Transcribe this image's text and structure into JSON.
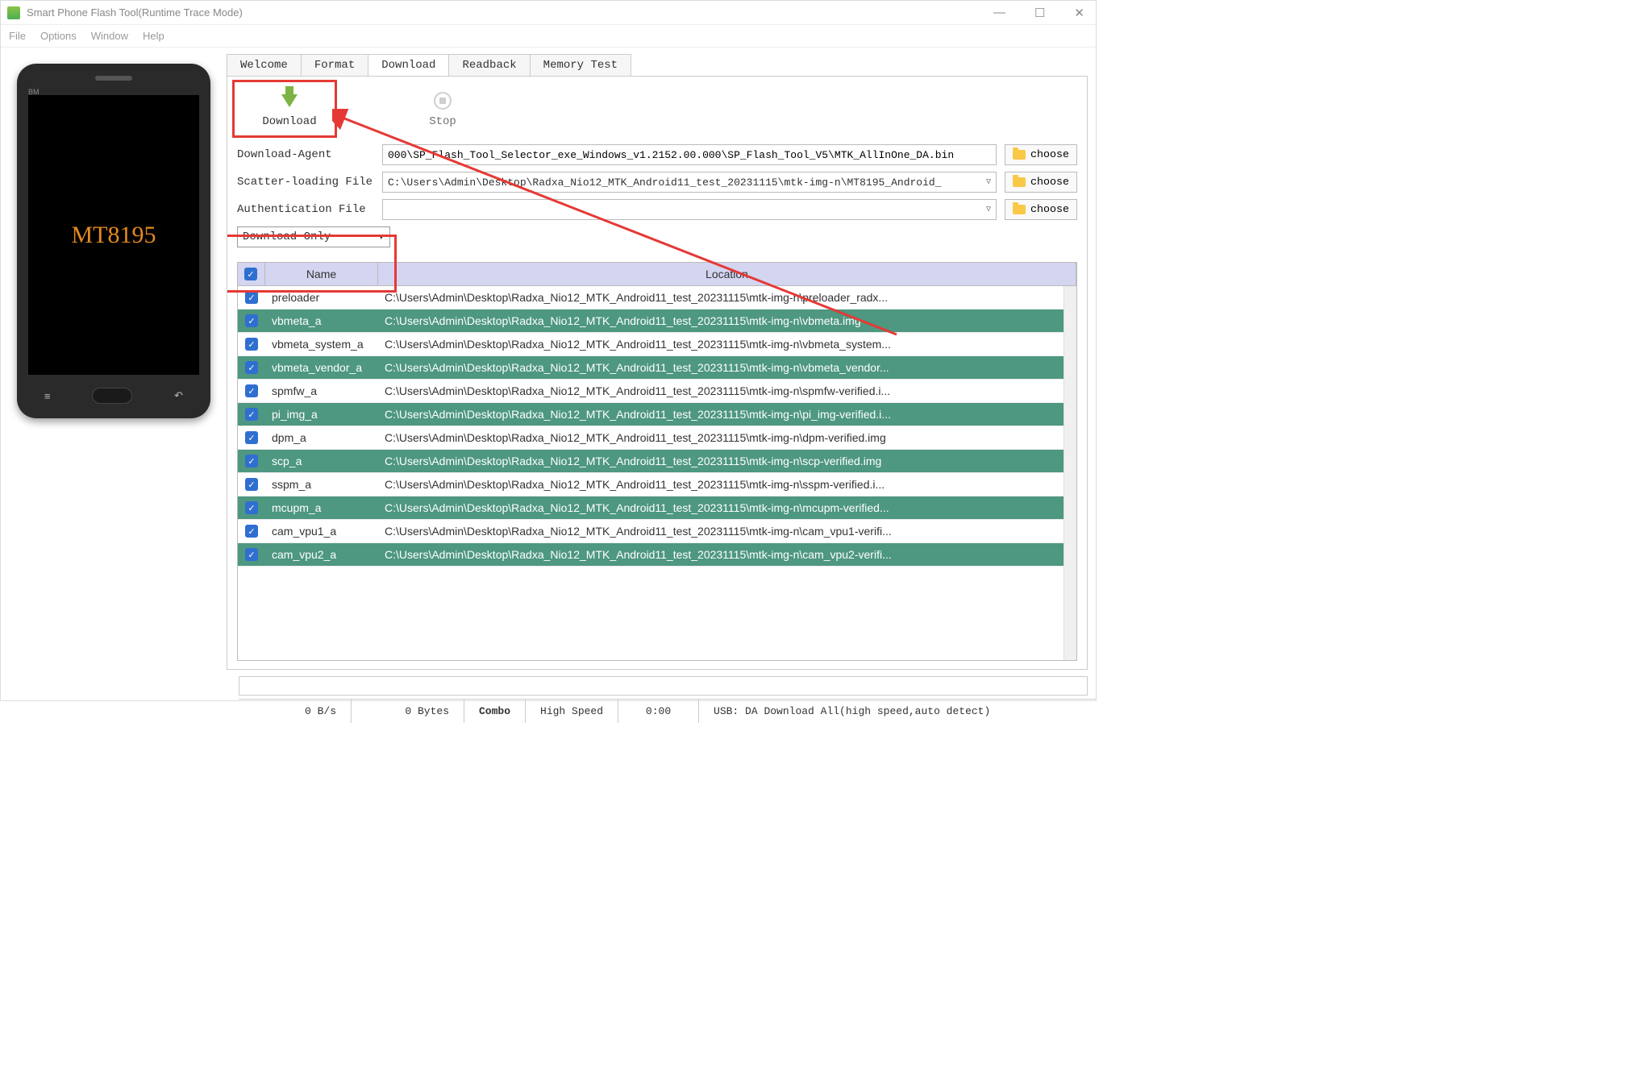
{
  "window": {
    "title": "Smart Phone Flash Tool(Runtime Trace Mode)"
  },
  "menu": {
    "items": [
      "File",
      "Options",
      "Window",
      "Help"
    ]
  },
  "phone": {
    "brand_mark": "BM",
    "screen_text": "MT8195"
  },
  "tabs": [
    "Welcome",
    "Format",
    "Download",
    "Readback",
    "Memory Test"
  ],
  "active_tab": "Download",
  "toolbar": {
    "download_label": "Download",
    "stop_label": "Stop"
  },
  "form": {
    "da_label": "Download-Agent",
    "da_value": "000\\SP_Flash_Tool_Selector_exe_Windows_v1.2152.00.000\\SP_Flash_Tool_V5\\MTK_AllInOne_DA.bin",
    "scatter_label": "Scatter-loading File",
    "scatter_value": "C:\\Users\\Admin\\Desktop\\Radxa_Nio12_MTK_Android11_test_20231115\\mtk-img-n\\MT8195_Android_",
    "auth_label": "Authentication File",
    "auth_value": "",
    "choose_label": "choose",
    "mode_value": "Download Only"
  },
  "table": {
    "headers": {
      "name": "Name",
      "location": "Location"
    },
    "rows": [
      {
        "checked": true,
        "name": "preloader",
        "location": "C:\\Users\\Admin\\Desktop\\Radxa_Nio12_MTK_Android11_test_20231115\\mtk-img-n\\preloader_radx..."
      },
      {
        "checked": true,
        "name": "vbmeta_a",
        "location": "C:\\Users\\Admin\\Desktop\\Radxa_Nio12_MTK_Android11_test_20231115\\mtk-img-n\\vbmeta.img"
      },
      {
        "checked": true,
        "name": "vbmeta_system_a",
        "location": "C:\\Users\\Admin\\Desktop\\Radxa_Nio12_MTK_Android11_test_20231115\\mtk-img-n\\vbmeta_system..."
      },
      {
        "checked": true,
        "name": "vbmeta_vendor_a",
        "location": "C:\\Users\\Admin\\Desktop\\Radxa_Nio12_MTK_Android11_test_20231115\\mtk-img-n\\vbmeta_vendor..."
      },
      {
        "checked": true,
        "name": "spmfw_a",
        "location": "C:\\Users\\Admin\\Desktop\\Radxa_Nio12_MTK_Android11_test_20231115\\mtk-img-n\\spmfw-verified.i..."
      },
      {
        "checked": true,
        "name": "pi_img_a",
        "location": "C:\\Users\\Admin\\Desktop\\Radxa_Nio12_MTK_Android11_test_20231115\\mtk-img-n\\pi_img-verified.i..."
      },
      {
        "checked": true,
        "name": "dpm_a",
        "location": "C:\\Users\\Admin\\Desktop\\Radxa_Nio12_MTK_Android11_test_20231115\\mtk-img-n\\dpm-verified.img"
      },
      {
        "checked": true,
        "name": "scp_a",
        "location": "C:\\Users\\Admin\\Desktop\\Radxa_Nio12_MTK_Android11_test_20231115\\mtk-img-n\\scp-verified.img"
      },
      {
        "checked": true,
        "name": "sspm_a",
        "location": "C:\\Users\\Admin\\Desktop\\Radxa_Nio12_MTK_Android11_test_20231115\\mtk-img-n\\sspm-verified.i..."
      },
      {
        "checked": true,
        "name": "mcupm_a",
        "location": "C:\\Users\\Admin\\Desktop\\Radxa_Nio12_MTK_Android11_test_20231115\\mtk-img-n\\mcupm-verified..."
      },
      {
        "checked": true,
        "name": "cam_vpu1_a",
        "location": "C:\\Users\\Admin\\Desktop\\Radxa_Nio12_MTK_Android11_test_20231115\\mtk-img-n\\cam_vpu1-verifi..."
      },
      {
        "checked": true,
        "name": "cam_vpu2_a",
        "location": "C:\\Users\\Admin\\Desktop\\Radxa_Nio12_MTK_Android11_test_20231115\\mtk-img-n\\cam_vpu2-verifi..."
      }
    ]
  },
  "statusbar": {
    "speed": "0 B/s",
    "bytes": "0 Bytes",
    "mode": "Combo",
    "link": "High Speed",
    "time": "0:00",
    "usb": "USB: DA Download All(high speed,auto detect)"
  }
}
